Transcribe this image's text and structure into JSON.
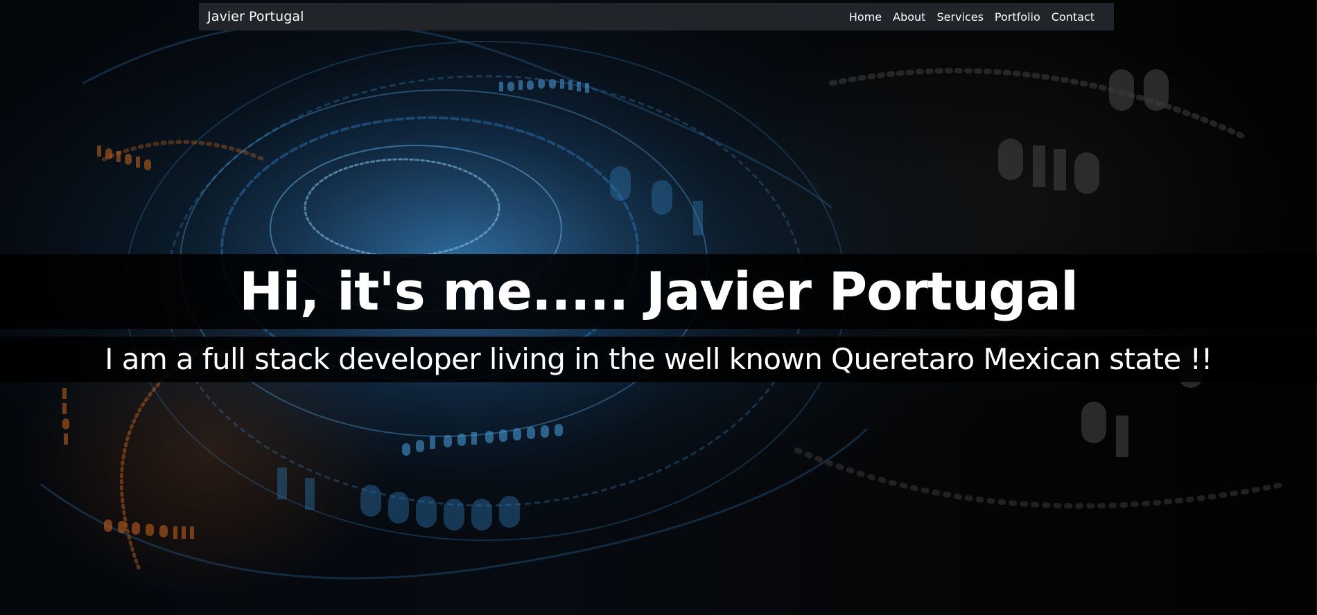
{
  "navbar": {
    "brand": "Javier Portugal",
    "links": [
      "Home",
      "About",
      "Services",
      "Portfolio",
      "Contact"
    ]
  },
  "hero": {
    "title": "Hi, it's me..... Javier Portugal",
    "subtitle": "I am a full stack developer living in the well known Queretaro Mexican state !!"
  },
  "colors": {
    "navbar_bg": "#212529",
    "text": "#ffffff",
    "background": "#000000",
    "accent_blue": "#3fa0e0",
    "accent_orange": "#d9732a"
  }
}
